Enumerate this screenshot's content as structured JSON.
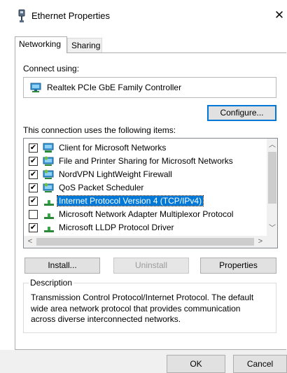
{
  "window": {
    "title": "Ethernet Properties",
    "close_glyph": "✕"
  },
  "tabs": [
    {
      "label": "Networking",
      "active": true
    },
    {
      "label": "Sharing",
      "active": false
    }
  ],
  "connect_using": {
    "label": "Connect using:",
    "adapter_name": "Realtek PCIe GbE Family Controller",
    "adapter_icon": "network-adapter-icon",
    "configure_label": "Configure..."
  },
  "items": {
    "label": "This connection uses the following items:",
    "list": [
      {
        "checked": true,
        "icon": "network-client-icon",
        "text": "Client for Microsoft Networks",
        "selected": false
      },
      {
        "checked": true,
        "icon": "network-service-icon",
        "text": "File and Printer Sharing for Microsoft Networks",
        "selected": false
      },
      {
        "checked": true,
        "icon": "network-service-icon",
        "text": "NordVPN LightWeight Firewall",
        "selected": false
      },
      {
        "checked": true,
        "icon": "network-service-icon",
        "text": "QoS Packet Scheduler",
        "selected": false
      },
      {
        "checked": true,
        "icon": "protocol-icon",
        "text": "Internet Protocol Version 4 (TCP/IPv4)",
        "selected": true
      },
      {
        "checked": false,
        "icon": "protocol-icon",
        "text": "Microsoft Network Adapter Multiplexor Protocol",
        "selected": false
      },
      {
        "checked": true,
        "icon": "protocol-icon",
        "text": "Microsoft LLDP Protocol Driver",
        "selected": false
      }
    ],
    "check_glyph": "✔",
    "scroll_glyphs": {
      "up": "︿",
      "down": "﹀",
      "left": "<",
      "right": ">"
    }
  },
  "buttons": {
    "install": "Install...",
    "uninstall": "Uninstall",
    "properties": "Properties",
    "ok": "OK",
    "cancel": "Cancel"
  },
  "description": {
    "legend": "Description",
    "lines": [
      "Transmission Control Protocol/Internet Protocol. The default",
      "wide area network protocol that provides communication",
      "across diverse interconnected networks."
    ]
  },
  "colors": {
    "selection": "#0078d7",
    "button_face": "#e1e1e1",
    "dialog_face": "#f0f0f0"
  }
}
